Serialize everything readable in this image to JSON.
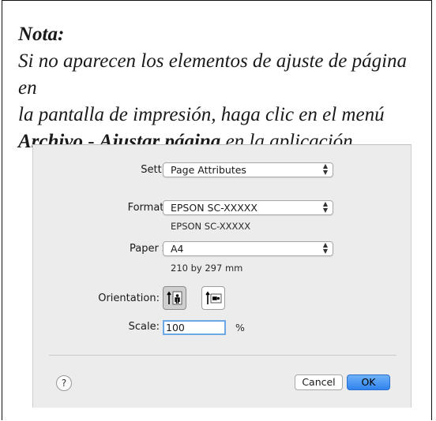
{
  "note": {
    "title": "Nota:",
    "line1": "Si no aparecen los elementos de ajuste de página en",
    "line2": "la pantalla de impresión, haga clic en el menú",
    "menu_file": "Archivo",
    "separator": " - ",
    "menu_page": "Ajustar página",
    "line3_end": " en la aplicación."
  },
  "dialog": {
    "settings_label": "Settings:",
    "settings_value": "Page Attributes",
    "format_label": "Format For:",
    "format_value": "EPSON SC-XXXXX",
    "format_sub": "EPSON SC-XXXXX",
    "paper_label": "Paper Size:",
    "paper_value": "A4",
    "paper_sub": "210 by 297 mm",
    "orientation_label": "Orientation:",
    "orientation_selected": "portrait",
    "scale_label": "Scale:",
    "scale_value": "100",
    "scale_unit": "%",
    "help_glyph": "?",
    "cancel_label": "Cancel",
    "ok_label": "OK",
    "stepper_glyph": "⌃⌄",
    "accent": "#3b8cf0"
  }
}
